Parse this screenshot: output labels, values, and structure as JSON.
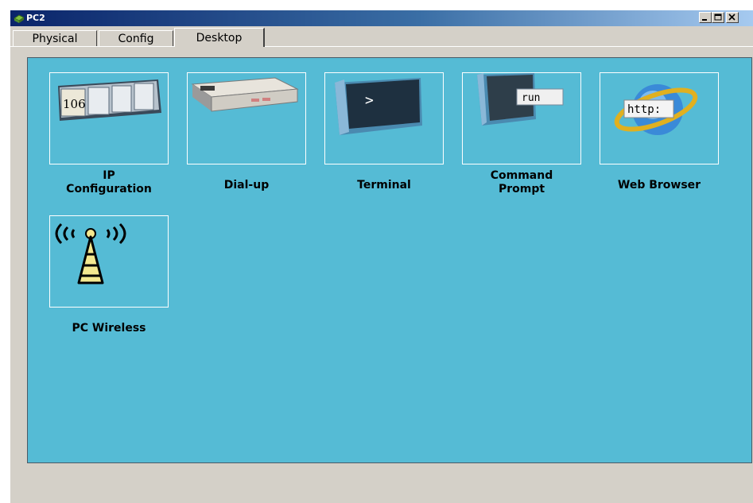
{
  "window": {
    "title": "PC2",
    "controls": {
      "minimize": "_",
      "maximize": "□",
      "close": "X"
    }
  },
  "tabs": [
    {
      "label": "Physical",
      "selected": false
    },
    {
      "label": "Config",
      "selected": false
    },
    {
      "label": "Desktop",
      "selected": true
    }
  ],
  "apps": [
    {
      "label": "IP Configuration",
      "icon": "ip-configuration-icon",
      "icon_text": "106"
    },
    {
      "label": "Dial-up",
      "icon": "dial-up-modem-icon"
    },
    {
      "label": "Terminal",
      "icon": "terminal-icon",
      "icon_text": ">"
    },
    {
      "label": "Command Prompt",
      "icon": "command-prompt-icon",
      "icon_text": "run"
    },
    {
      "label": "Web Browser",
      "icon": "web-browser-icon",
      "icon_text": "http:"
    },
    {
      "label": "PC Wireless",
      "icon": "wireless-tower-icon"
    }
  ],
  "colors": {
    "desktop_background": "#55bbd5",
    "window_background": "#d4d0c8",
    "titlebar": "#0a246a"
  }
}
